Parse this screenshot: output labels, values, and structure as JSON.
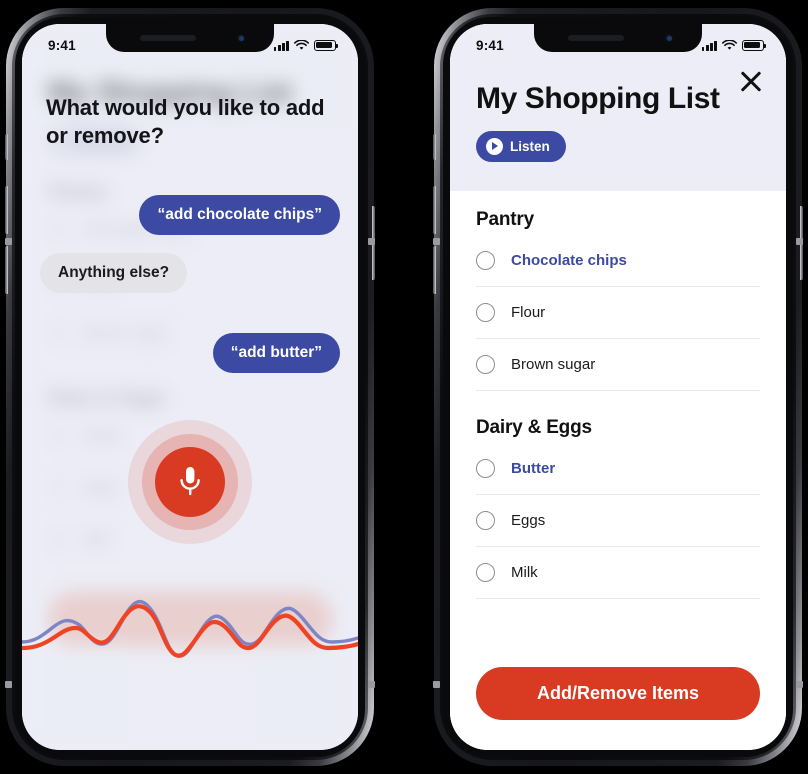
{
  "status_bar": {
    "time": "9:41",
    "signal_icon": "cellular-bars-icon",
    "wifi_icon": "wifi-icon",
    "battery_icon": "battery-icon"
  },
  "voice_screen": {
    "prompt": "What would you like to add or remove?",
    "messages": [
      {
        "from": "user",
        "text": "“add chocolate chips”"
      },
      {
        "from": "assistant",
        "text": "Anything else?"
      },
      {
        "from": "user",
        "text": "“add butter”"
      }
    ],
    "mic_icon": "microphone-icon",
    "mic_color": "#d93a22",
    "waveform_icon": "audio-waveform-icon",
    "waveform_colors": {
      "primary": "#ef4423",
      "secondary": "#7d85c4"
    },
    "background": {
      "title": "My Shopping List",
      "section_one": "Pantry",
      "section_two": "Dairy & Eggs",
      "items": [
        "Chocolate chips",
        "Flour",
        "Brown sugar",
        "Butter",
        "Eggs",
        "Milk"
      ],
      "cta": "Add/Remove Items"
    }
  },
  "list_screen": {
    "close_icon": "close-icon",
    "title": "My Shopping List",
    "listen_button": {
      "label": "Listen",
      "icon": "play-circle-icon"
    },
    "sections": [
      {
        "title": "Pantry",
        "items": [
          {
            "label": "Chocolate chips",
            "highlighted": true,
            "checkbox_icon": "checkbox-circle-icon"
          },
          {
            "label": "Flour",
            "highlighted": false,
            "checkbox_icon": "checkbox-circle-icon"
          },
          {
            "label": "Brown sugar",
            "highlighted": false,
            "checkbox_icon": "checkbox-circle-icon"
          }
        ]
      },
      {
        "title": "Dairy & Eggs",
        "items": [
          {
            "label": "Butter",
            "highlighted": true,
            "checkbox_icon": "checkbox-circle-icon"
          },
          {
            "label": "Eggs",
            "highlighted": false,
            "checkbox_icon": "checkbox-circle-icon"
          },
          {
            "label": "Milk",
            "highlighted": false,
            "checkbox_icon": "checkbox-circle-icon"
          }
        ]
      }
    ],
    "cta": "Add/Remove Items"
  },
  "colors": {
    "brand_blue": "#3c4aa3",
    "brand_red": "#d93a22",
    "screen_bg": "#ecedf6"
  }
}
